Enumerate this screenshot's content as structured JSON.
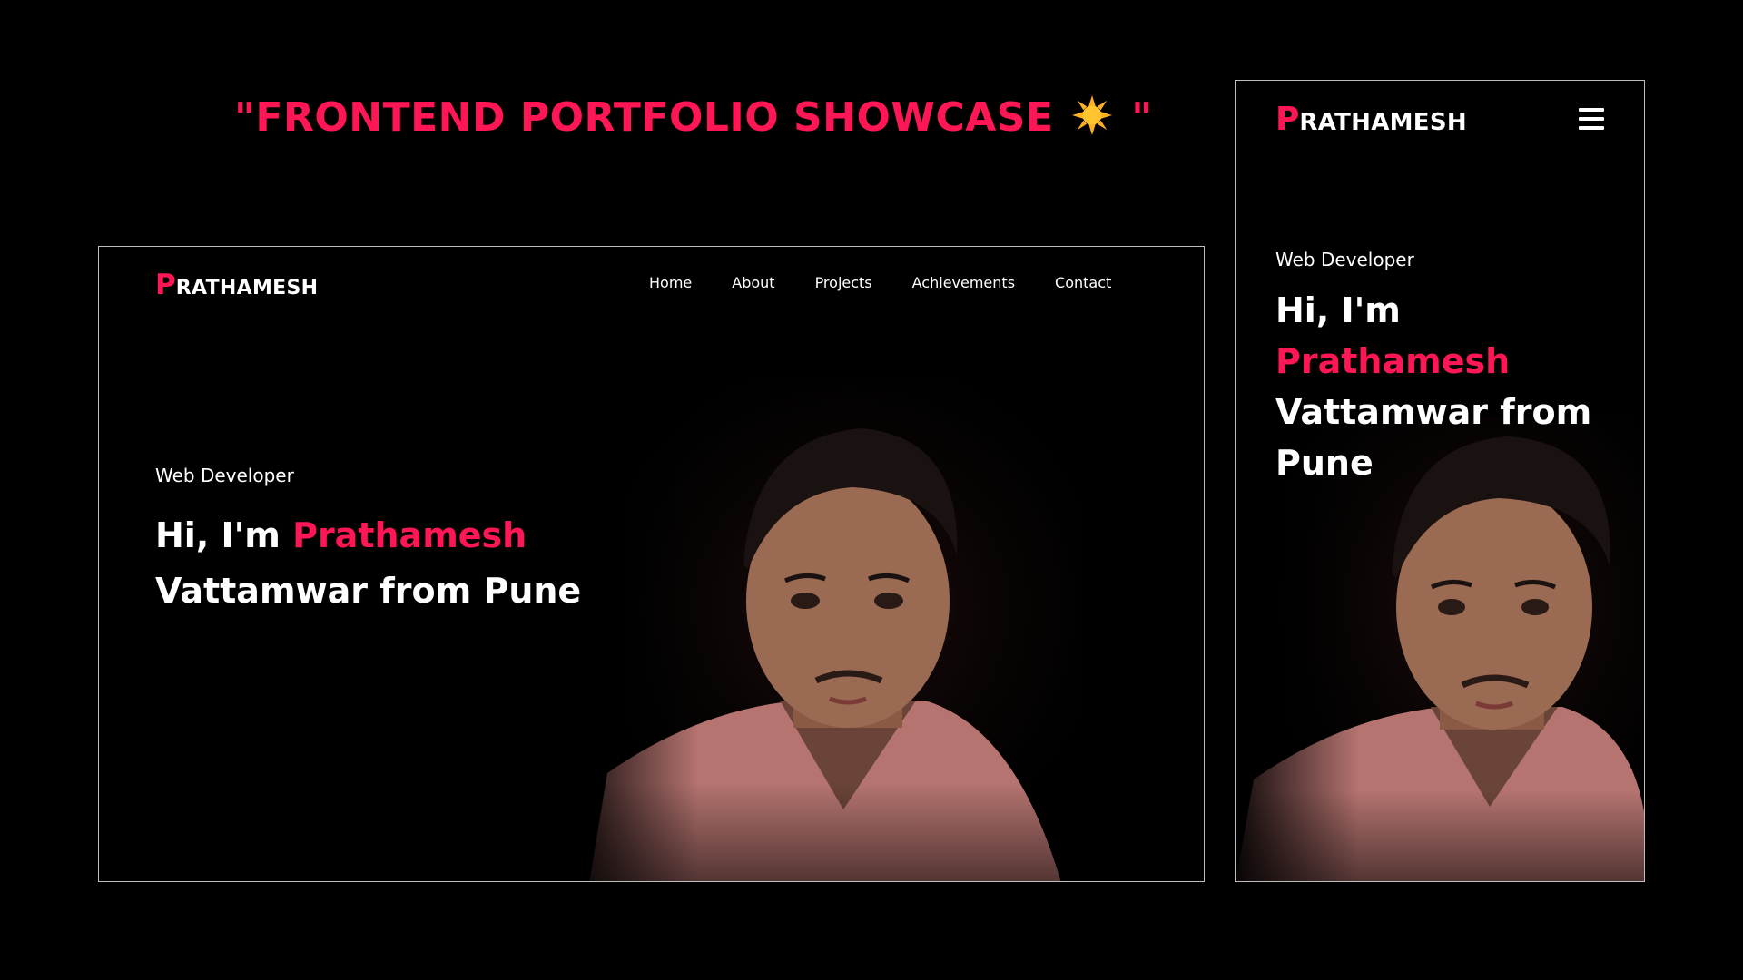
{
  "headline": {
    "prefix": "\"FRONTEND PORTFOLIO SHOWCASE",
    "suffix": "\"",
    "icon": "sun-icon"
  },
  "desktop": {
    "logo": {
      "first": "P",
      "rest": "RATHAMESH"
    },
    "nav": [
      "Home",
      "About",
      "Projects",
      "Achievements",
      "Contact"
    ],
    "role": "Web Developer",
    "hero": {
      "greeting": "Hi, I'm ",
      "name": "Prathamesh",
      "rest": "Vattamwar from Pune"
    }
  },
  "mobile": {
    "logo": {
      "first": "P",
      "rest": "RATHAMESH"
    },
    "menu_icon": "hamburger-menu-icon",
    "role": "Web Developer",
    "hero": {
      "greeting": "Hi, I'm ",
      "name": "Prathamesh",
      "rest": "Vattamwar from Pune"
    }
  },
  "colors": {
    "accent": "#ff1654",
    "background": "#000000",
    "text": "#ffffff",
    "frame_border": "#bdbdbd"
  }
}
